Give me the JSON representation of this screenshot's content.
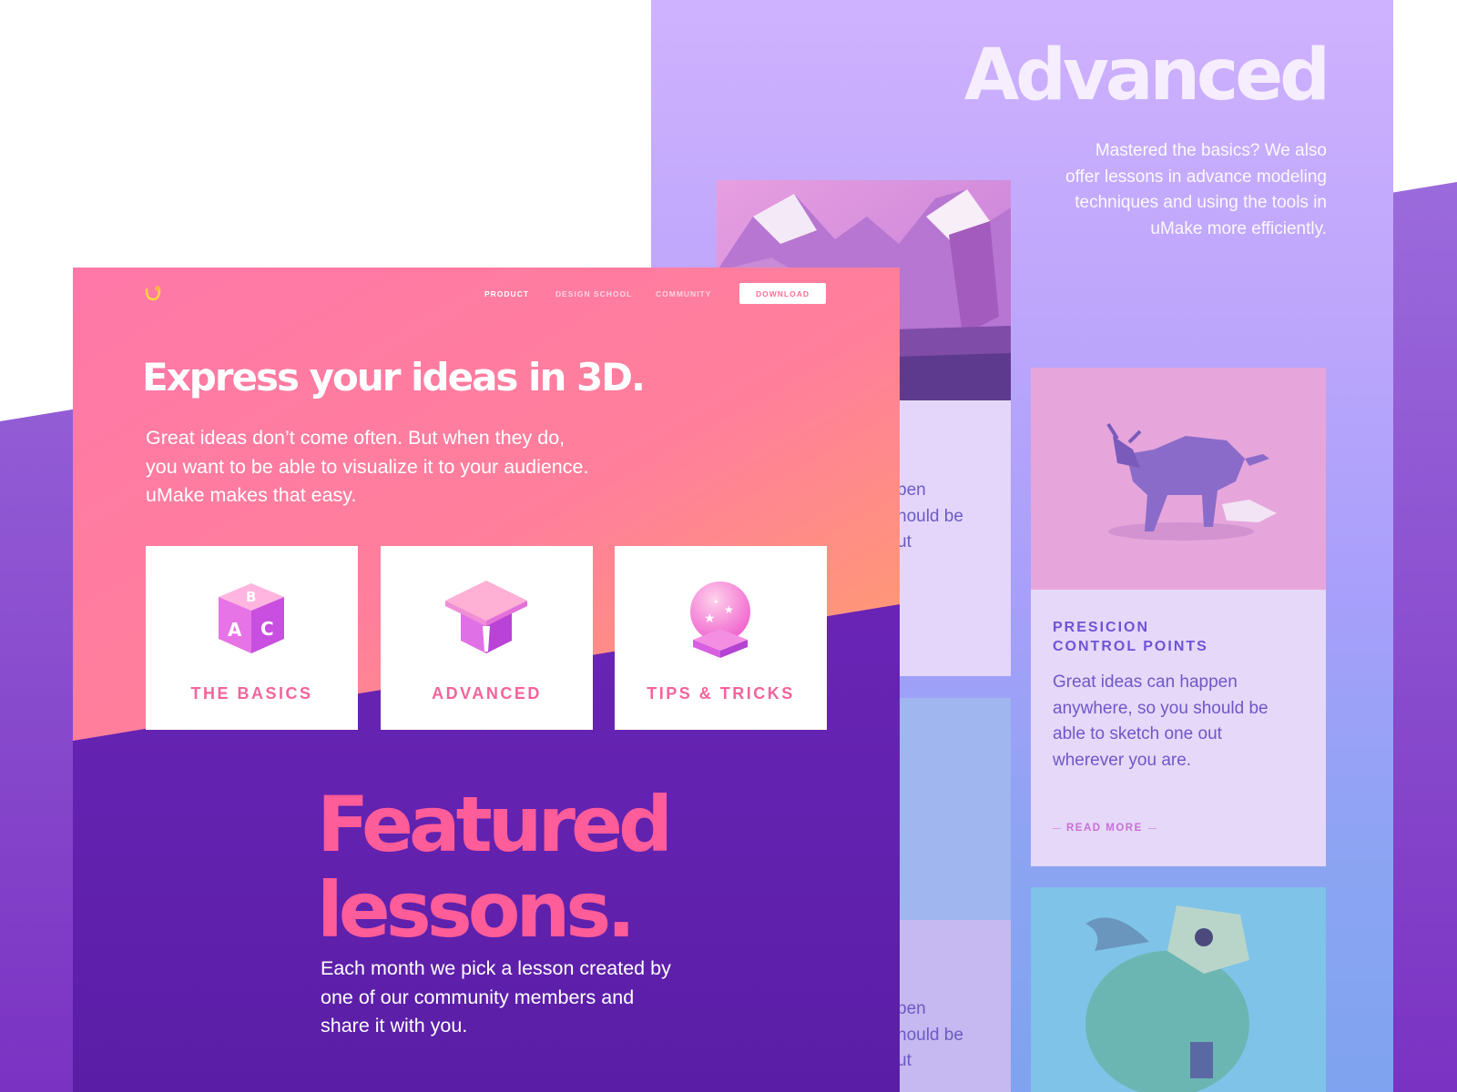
{
  "back_page": {
    "title": "Advanced",
    "description": "Mastered the basics? We also offer lessons in advance modeling techniques and using the tools in uMake more efficiently.",
    "left_cards": [
      {
        "text_fragment": "...pen\n...hould be\n...ut"
      },
      {
        "text_fragment": "...pen\n...hould be\n...ut"
      }
    ],
    "feature_card": {
      "title_line1": "PRESICION",
      "title_line2": "CONTROL POINTS",
      "body": "Great ideas can happen anywhere, so you should be able to sketch one out wherever you are.",
      "read_more": "READ MORE"
    }
  },
  "front_page": {
    "nav": {
      "product": "PRODUCT",
      "design_school": "DESIGN SCHOOL",
      "community": "COMMUNITY",
      "download": "DOWNLOAD"
    },
    "hero": {
      "title": "Express your ideas in 3D.",
      "description": "Great ideas don’t come often. But when they do, you want to be able to visualize it to your audience. uMake makes that easy."
    },
    "categories": [
      {
        "label": "THE BASICS",
        "icon": "abc-block-icon"
      },
      {
        "label": "ADVANCED",
        "icon": "graduation-cap-icon"
      },
      {
        "label": "TIPS & TRICKS",
        "icon": "crystal-ball-icon"
      }
    ],
    "featured": {
      "title_line1": "Featured",
      "title_line2": "lessons.",
      "description": "Each month we pick a lesson created by one of our community members and share it with you."
    }
  },
  "colors": {
    "pink_accent": "#ff5c9a",
    "purple_dark": "#6322b5",
    "lavender": "#c0a7fb",
    "card_title_purple": "#6d54d6"
  }
}
